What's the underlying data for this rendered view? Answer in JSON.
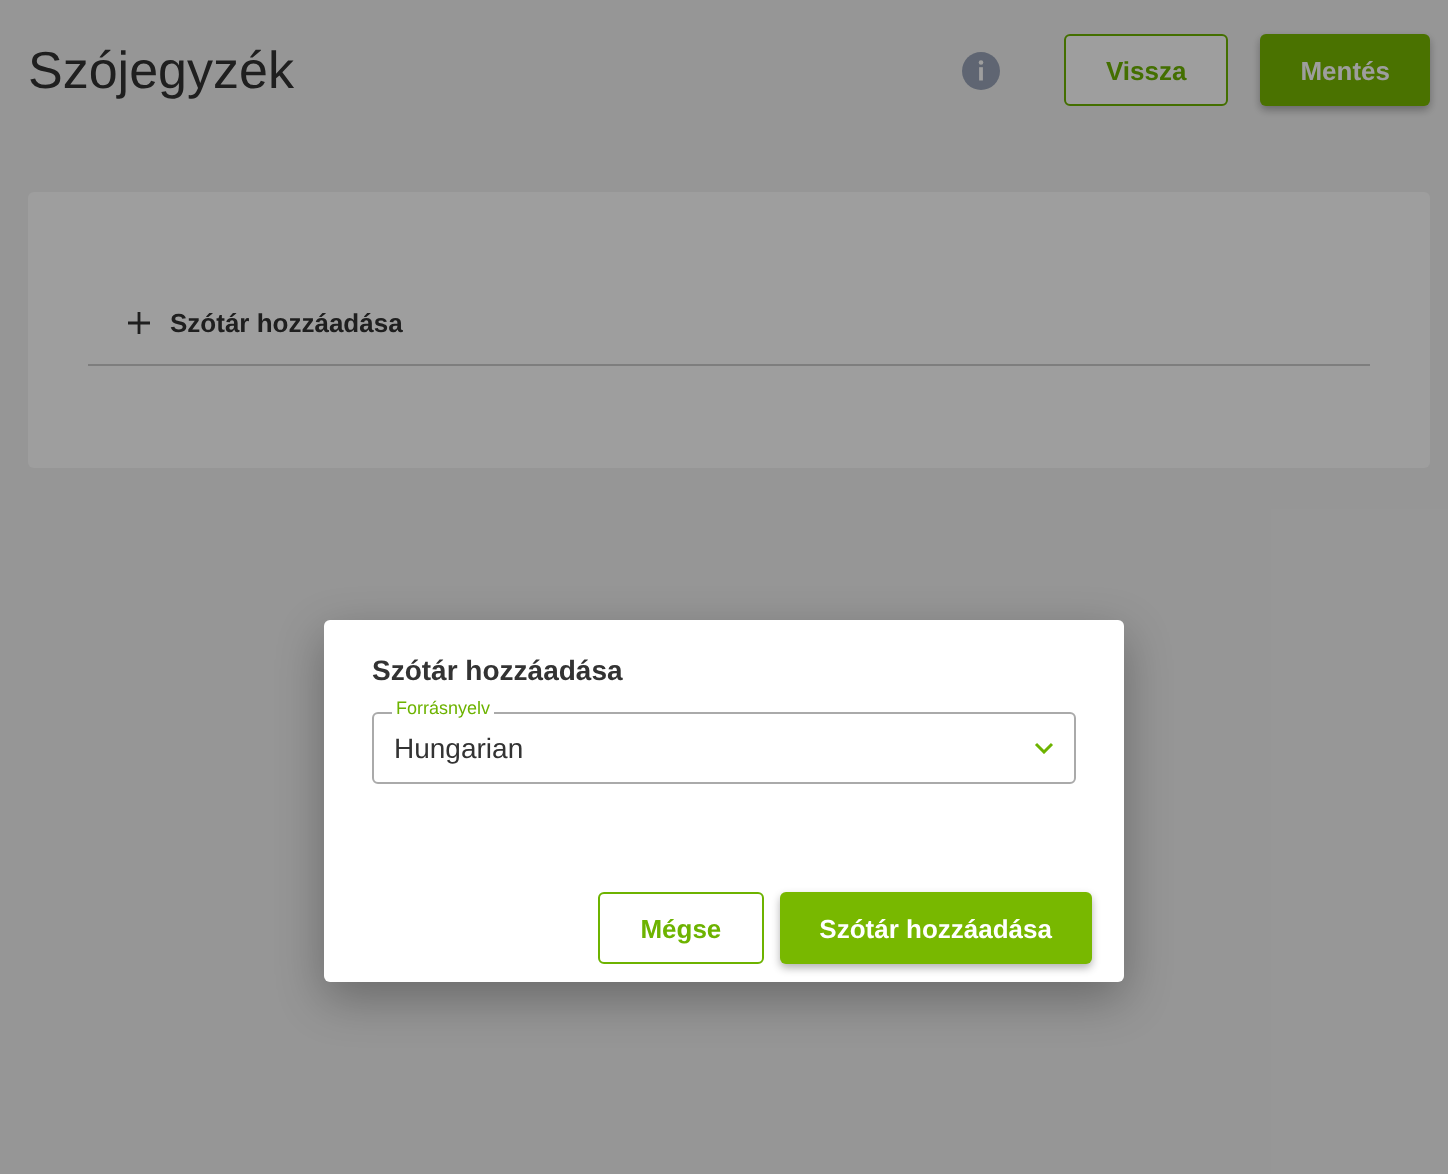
{
  "page": {
    "title": "Szójegyzék",
    "buttons": [
      {
        "label": "Vissza",
        "kind": "outline"
      },
      {
        "label": "Mentés",
        "kind": "primary"
      }
    ],
    "add_row": {
      "label": "Szótár hozzáadása"
    }
  },
  "dialog": {
    "title": "Szótár hozzáadása",
    "field": {
      "label": "Forrásnyelv",
      "value": "Hungarian"
    },
    "buttons": [
      {
        "label": "Mégse",
        "kind": "outline"
      },
      {
        "label": "Szótár hozzáadása",
        "kind": "primary"
      }
    ]
  }
}
